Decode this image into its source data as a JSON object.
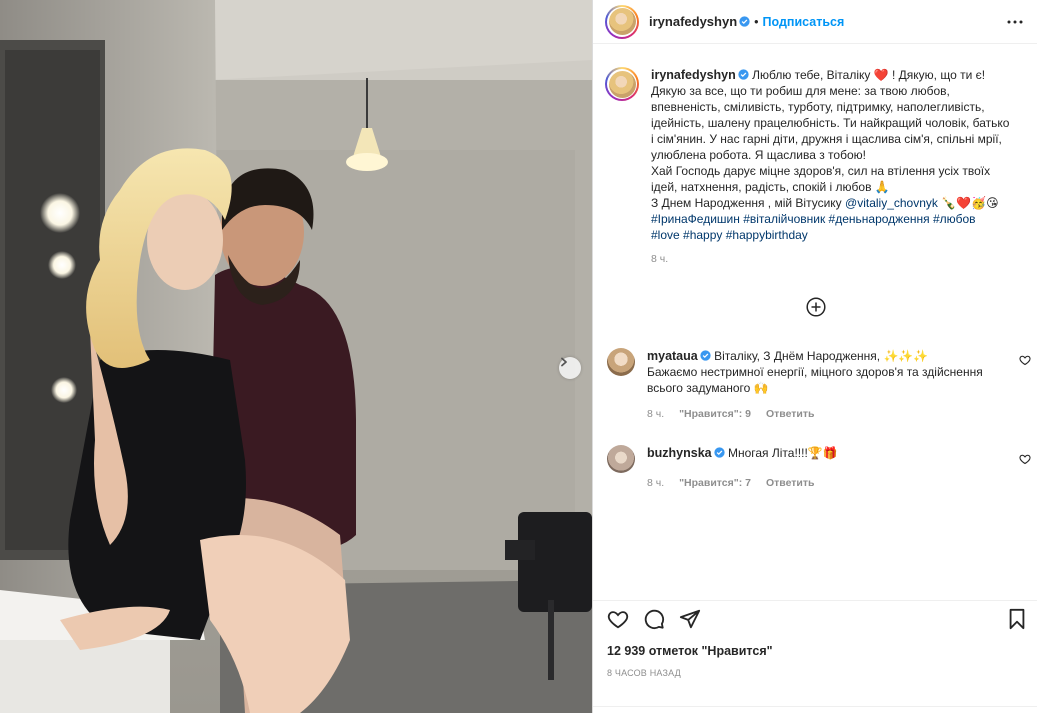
{
  "post": {
    "username": "irynafedyshyn",
    "follow_label": "Подписаться",
    "caption_prefix": "Люблю тебе, Віталіку ❤️ ! Дякую, що ти є!\nДякую за все, що ти робиш для мене: за твою любов, впевненість, сміливість, турботу, підтримку, наполегливість, ідейність, шалену працелюбність. Ти найкращий чоловік, батько і сім'янин. У нас гарні діти, дружня і щаслива сім'я, спільні мрії, улюблена робота. Я щаслива з тобою!\nХай Господь дарує міцне здоров'я, сил на втілення усіх твоїх ідей, натхнення, радість, спокій і любов 🙏\nЗ Днем Народження , мій Вітусику ",
    "mention": "@vitaliy_chovnyk",
    "caption_emoji": " 🍾❤️🥳😘",
    "hashtags_line1": "#ІринаФедишин #віталійчовник #деньнародження #любов",
    "hashtags_line2": "#love #happy #happybirthday",
    "caption_time": "8 ч."
  },
  "comments": [
    {
      "username": "myataua",
      "text": "Віталіку, З Днём Народження, ✨✨✨\nБажаємо нестримної енергії, міцного здоров'я та здійснення всього задуманого 🙌",
      "time": "8 ч.",
      "likes": "\"Нравится\": 9",
      "reply": "Ответить"
    },
    {
      "username": "buzhynska",
      "text": "Многая Літа!!!!🏆🎁",
      "time": "8 ч.",
      "likes": "\"Нравится\": 7",
      "reply": "Ответить"
    }
  ],
  "footer": {
    "likes_text": "12 939 отметок \"Нравится\"",
    "time_ago": "8 ЧАСОВ НАЗАД"
  },
  "icons": [
    "verified-badge",
    "more-icon",
    "add-comment-icon",
    "heart-icon",
    "comment-icon",
    "share-icon",
    "bookmark-icon",
    "next-arrow-icon"
  ],
  "colors": {
    "link": "#0095f6",
    "hashtag": "#00376b",
    "muted": "#8e8e8e"
  }
}
